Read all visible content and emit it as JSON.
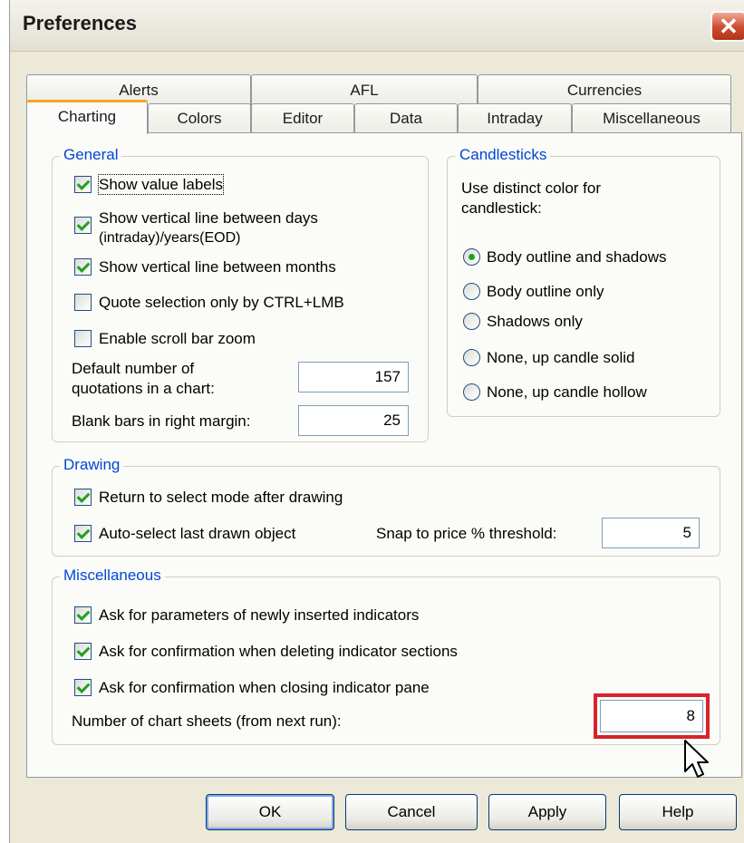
{
  "window": {
    "title": "Preferences"
  },
  "tabs_back": [
    "Alerts",
    "AFL",
    "Currencies"
  ],
  "tabs_front": [
    "Charting",
    "Colors",
    "Editor",
    "Data",
    "Intraday",
    "Miscellaneous"
  ],
  "active_tab": "Charting",
  "general": {
    "legend": "General",
    "show_value_labels": {
      "label": "Show value labels",
      "checked": true
    },
    "vertical_days": {
      "label_line1": "Show vertical line between days",
      "label_line2": "(intraday)/years(EOD)",
      "checked": true
    },
    "vertical_months": {
      "label": "Show vertical line between months",
      "checked": true
    },
    "quote_selection": {
      "label": "Quote selection only by CTRL+LMB",
      "checked": false
    },
    "scroll_zoom": {
      "label": "Enable scroll bar zoom",
      "checked": false
    },
    "default_quotations": {
      "label_line1": "Default number of",
      "label_line2": "quotations in a chart:",
      "value": "157"
    },
    "blank_bars": {
      "label": "Blank bars in right margin:",
      "value": "25"
    }
  },
  "candlesticks": {
    "legend": "Candlesticks",
    "intro_line1": "Use distinct color for",
    "intro_line2": "candlestick:",
    "options": [
      {
        "label": "Body outline and shadows",
        "checked": true
      },
      {
        "label": "Body outline only",
        "checked": false
      },
      {
        "label": "Shadows only",
        "checked": false
      },
      {
        "label": "None, up candle solid",
        "checked": false
      },
      {
        "label": "None, up candle hollow",
        "checked": false
      }
    ]
  },
  "drawing": {
    "legend": "Drawing",
    "return_select": {
      "label": "Return to select mode after drawing",
      "checked": true
    },
    "auto_select": {
      "label": "Auto-select last drawn object",
      "checked": true
    },
    "snap_label": "Snap to price % threshold:",
    "snap_value": "5"
  },
  "misc": {
    "legend": "Miscellaneous",
    "ask_params": {
      "label": "Ask for parameters of newly inserted indicators",
      "checked": true
    },
    "confirm_delete": {
      "label": "Ask for confirmation when deleting indicator sections",
      "checked": true
    },
    "confirm_close": {
      "label": "Ask for confirmation when closing indicator pane",
      "checked": true
    },
    "chart_sheets_label": "Number of chart sheets (from next run):",
    "chart_sheets_value": "8"
  },
  "buttons": {
    "ok": "OK",
    "cancel": "Cancel",
    "apply": "Apply",
    "help": "Help"
  },
  "colors": {
    "highlight": "#d8232a",
    "legend_text": "#0046d5",
    "check": "#21a121"
  }
}
